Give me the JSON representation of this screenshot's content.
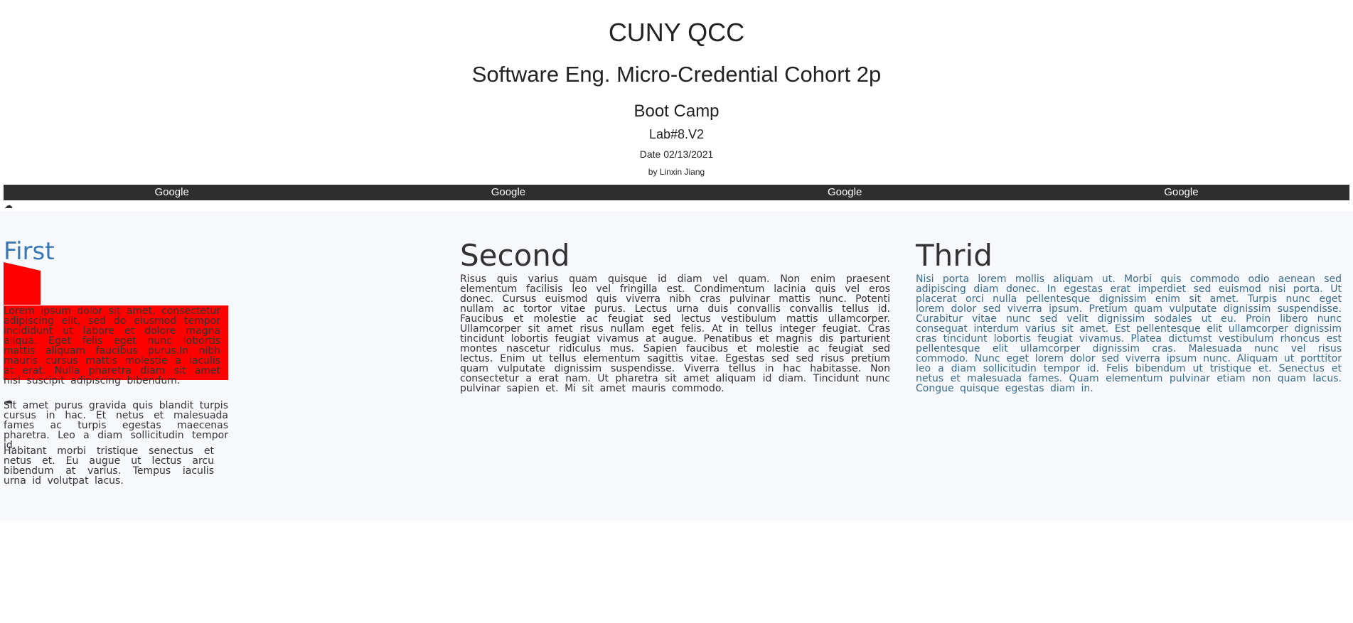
{
  "header": {
    "title": "CUNY QCC",
    "subtitle": "Software Eng. Micro-Credential Cohort 2p",
    "course": "Boot Camp",
    "lab": "Lab#8.V2",
    "date": "Date 02/13/2021",
    "author": "by Linxin Jiang"
  },
  "nav": {
    "links": [
      "Google",
      "Google",
      "Google",
      "Google"
    ]
  },
  "icons": {
    "nav_icon": "cloud-icon",
    "col1_icon": "cloud-icon"
  },
  "columns": {
    "first": {
      "title": "First",
      "p1": "Lorem ipsum dolor sit amet, consectetur adipiscing elit, sed do eiusmod tempor incididunt ut labore et dolore magna aliqua. Eget felis eget nunc lobortis mattis aliquam faucibus purus.In nibh mauris cursus mattis molestie a iaculis at erat. Nulla pharetra diam sit amet nisl suscipit adipiscing bibendum.",
      "p2": "Sit amet purus gravida quis blandit turpis cursus in hac. Et netus et malesuada fames ac turpis egestas maecenas pharetra. Leo a diam sollicitudin tempor id.",
      "p3": "Habitant morbi tristique senectus et netus et. Eu augue ut lectus arcu bibendum at varius. Tempus iaculis urna id volutpat lacus."
    },
    "second": {
      "title": "Second",
      "text": "Risus quis varius quam quisque id diam vel quam. Non enim praesent elementum facilisis leo vel fringilla est. Condimentum lacinia quis vel eros donec. Cursus euismod quis viverra nibh cras pulvinar mattis nunc. Potenti nullam ac tortor vitae purus. Lectus urna duis convallis convallis tellus id. Faucibus et molestie ac feugiat sed lectus vestibulum mattis ullamcorper. Ullamcorper sit amet risus nullam eget felis. At in tellus integer feugiat. Cras tincidunt lobortis feugiat vivamus at augue. Penatibus et magnis dis parturient montes nascetur ridiculus mus. Sapien faucibus et molestie ac feugiat sed lectus. Enim ut tellus elementum sagittis vitae. Egestas sed sed risus pretium quam vulputate dignissim suspendisse. Viverra tellus in hac habitasse. Non consectetur a erat nam. Ut pharetra sit amet aliquam id diam. Tincidunt nunc pulvinar sapien et. Mi sit amet mauris commodo."
    },
    "third": {
      "title": "Thrid",
      "text": "Nisi porta lorem mollis aliquam ut. Morbi quis commodo odio aenean sed adipiscing diam donec. In egestas erat imperdiet sed euismod nisi porta. Ut placerat orci nulla pellentesque dignissim enim sit amet. Turpis nunc eget lorem dolor sed viverra ipsum. Pretium quam vulputate dignissim suspendisse. Curabitur vitae nunc sed velit dignissim sodales ut eu. Proin libero nunc consequat interdum varius sit amet. Est pellentesque elit ullamcorper dignissim cras tincidunt lobortis feugiat vivamus. Platea dictumst vestibulum rhoncus est pellentesque elit ullamcorper dignissim cras. Malesuada nunc vel risus commodo. Nunc eget lorem dolor sed viverra ipsum nunc. Aliquam ut porttitor leo a diam sollicitudin tempor id. Felis bibendum ut tristique et. Senectus et netus et malesuada fames. Quam elementum pulvinar etiam non quam lacus. Congue quisque egestas diam in."
    }
  },
  "colors": {
    "navbar": "#2e2e2e",
    "main_bg": "#f7f8fb",
    "red_block": "#ff0000",
    "first_title": "#3a78b5",
    "third_text": "#3a6c8c"
  }
}
